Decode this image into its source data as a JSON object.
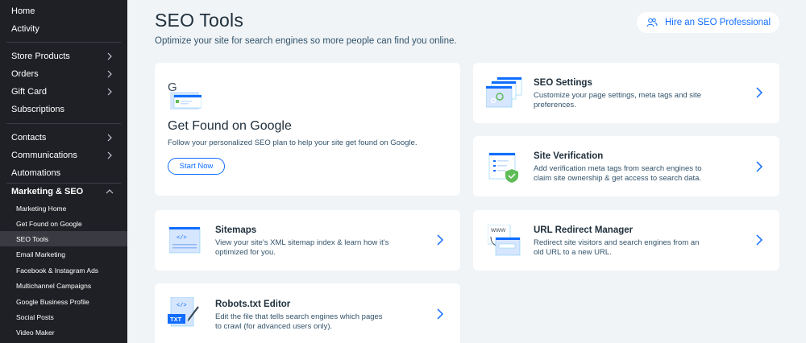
{
  "sidebar": {
    "items": [
      {
        "label": "Home"
      },
      {
        "label": "Activity"
      },
      {
        "label": "Store Products"
      },
      {
        "label": "Orders"
      },
      {
        "label": "Gift Card"
      },
      {
        "label": "Subscriptions"
      },
      {
        "label": "Contacts"
      },
      {
        "label": "Communications"
      },
      {
        "label": "Automations"
      },
      {
        "label": "Marketing & SEO"
      }
    ],
    "sub_items": [
      {
        "label": "Marketing Home"
      },
      {
        "label": "Get Found on Google"
      },
      {
        "label": "SEO Tools"
      },
      {
        "label": "Email Marketing"
      },
      {
        "label": "Facebook & Instagram Ads"
      },
      {
        "label": "Multichannel Campaigns"
      },
      {
        "label": "Google Business Profile"
      },
      {
        "label": "Social Posts"
      },
      {
        "label": "Video Maker"
      }
    ]
  },
  "header": {
    "title": "SEO Tools",
    "subtitle": "Optimize your site for search engines so more people can find you online.",
    "hire_label": "Hire an SEO Professional"
  },
  "cards": {
    "google": {
      "title": "Get Found on Google",
      "desc": "Follow your personalized SEO plan to help your site get found on Google.",
      "button": "Start Now"
    },
    "seo_settings": {
      "title": "SEO Settings",
      "desc1": "Customize your page settings, meta tags and site",
      "desc2": "preferences."
    },
    "site_verification": {
      "title": "Site Verification",
      "desc1": "Add verification meta tags from search engines to",
      "desc2": "claim site ownership & get access to search data."
    },
    "sitemaps": {
      "title": "Sitemaps",
      "desc1": "View your site's XML sitemap index & learn how it's",
      "desc2": "optimized for you."
    },
    "url_redirect": {
      "title": "URL Redirect Manager",
      "desc1": "Redirect site visitors and search engines from an",
      "desc2": "old URL to a new URL."
    },
    "robots": {
      "title": "Robots.txt Editor",
      "desc1": "Edit the file that tells search engines which pages",
      "desc2": "to crawl (for advanced users only)."
    }
  },
  "illus": {
    "txt_label": "TXT",
    "www_label": "WWW",
    "code_label": "</>"
  },
  "colors": {
    "accent": "#116dff",
    "sidebar_bg": "#1f2026",
    "page_bg": "#f0f4f7"
  }
}
